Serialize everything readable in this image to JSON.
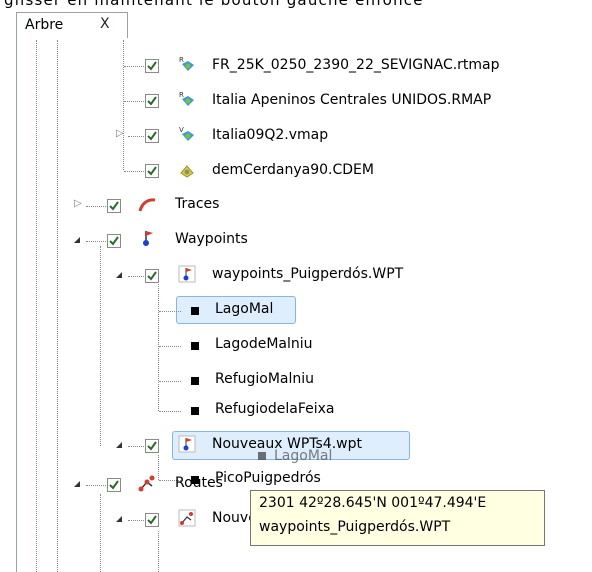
{
  "top_text": "glisser en maintenant le bouton gauche enfoncé",
  "tab": {
    "label": "Arbre",
    "close": "X"
  },
  "tree": {
    "maps": [
      {
        "label": "FR_25K_0250_2390_22_SEVIGNAC.rtmap",
        "badge": "R",
        "icon": "raster-map-icon"
      },
      {
        "label": "Italia Apeninos Centrales UNIDOS.RMAP",
        "badge": "R",
        "icon": "raster-map-icon"
      },
      {
        "label": "Italia09Q2.vmap",
        "badge": "V",
        "icon": "vector-map-icon"
      },
      {
        "label": "demCerdanya90.CDEM",
        "badge": "",
        "icon": "dem-icon"
      }
    ],
    "traces": {
      "label": "Traces"
    },
    "waypoints": {
      "label": "Waypoints"
    },
    "wpt_file": {
      "label": "waypoints_Puigperdós.WPT"
    },
    "wpt_items": [
      {
        "label": "LagoMal"
      },
      {
        "label": "LagodeMalniu"
      },
      {
        "label": "RefugioMalniu"
      },
      {
        "label": "RefugiodelaFeixa"
      }
    ],
    "new_file": {
      "label": "Nouveaux WPTs4.wpt"
    },
    "new_items": [
      {
        "label": "PicoPuigpedrós"
      }
    ],
    "routes": {
      "label": "Routes"
    },
    "route_file": {
      "label": "NouvelleRTE5.rte"
    }
  },
  "drag_ghost": {
    "label": "LagoMal"
  },
  "tooltip": {
    "line1": "2301  42º28.645'N 001º47.494'E",
    "line2": "waypoints_Puigperdós.WPT"
  }
}
